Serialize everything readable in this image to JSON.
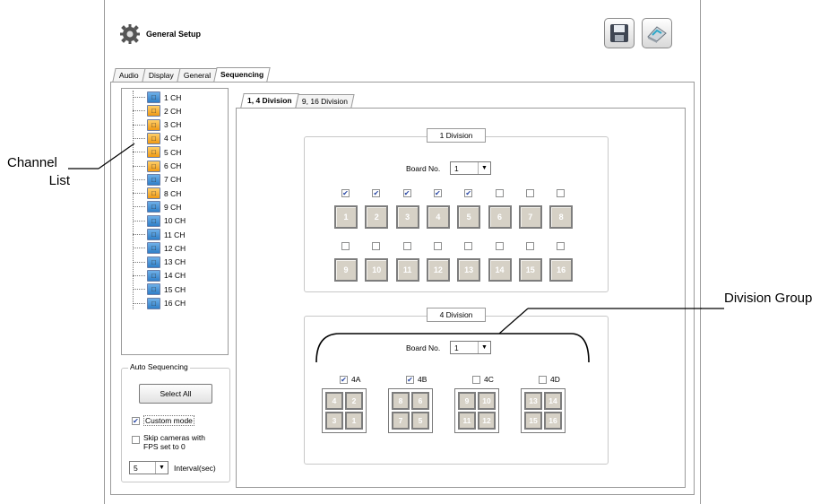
{
  "window": {
    "title": "General Setup"
  },
  "toolbar": {
    "save_icon": "floppy-disk-icon",
    "exit_icon": "exit-icon"
  },
  "main_tabs": [
    {
      "label": "Audio",
      "active": false
    },
    {
      "label": "Display",
      "active": false
    },
    {
      "label": "General",
      "active": false
    },
    {
      "label": "Sequencing",
      "active": true
    }
  ],
  "channel_list": {
    "items": [
      {
        "label": "1 CH",
        "color": "blue"
      },
      {
        "label": "2 CH",
        "color": "orange"
      },
      {
        "label": "3 CH",
        "color": "orange"
      },
      {
        "label": "4 CH",
        "color": "orange"
      },
      {
        "label": "5 CH",
        "color": "orange"
      },
      {
        "label": "6 CH",
        "color": "orange"
      },
      {
        "label": "7 CH",
        "color": "blue"
      },
      {
        "label": "8 CH",
        "color": "orange"
      },
      {
        "label": "9 CH",
        "color": "blue"
      },
      {
        "label": "10 CH",
        "color": "blue"
      },
      {
        "label": "11 CH",
        "color": "blue"
      },
      {
        "label": "12 CH",
        "color": "blue"
      },
      {
        "label": "13 CH",
        "color": "blue"
      },
      {
        "label": "14 CH",
        "color": "blue"
      },
      {
        "label": "15 CH",
        "color": "blue"
      },
      {
        "label": "16 CH",
        "color": "blue"
      }
    ]
  },
  "auto_sequencing": {
    "title": "Auto Sequencing",
    "select_all": "Select All",
    "custom_mode": {
      "label": "Custom mode",
      "checked": true
    },
    "skip_fps": {
      "label_line1": "Skip cameras with",
      "label_line2": "FPS set to 0",
      "checked": false
    },
    "interval": {
      "value": "5",
      "label": "Interval(sec)"
    }
  },
  "sub_tabs": [
    {
      "label": "1, 4 Division",
      "active": true
    },
    {
      "label": "9, 16 Division",
      "active": false
    }
  ],
  "division1": {
    "title": "1 Division",
    "board_label": "Board No.",
    "board_value": "1",
    "channels": [
      {
        "n": "1",
        "checked": true
      },
      {
        "n": "2",
        "checked": true
      },
      {
        "n": "3",
        "checked": true
      },
      {
        "n": "4",
        "checked": true
      },
      {
        "n": "5",
        "checked": true
      },
      {
        "n": "6",
        "checked": false
      },
      {
        "n": "7",
        "checked": false
      },
      {
        "n": "8",
        "checked": false
      },
      {
        "n": "9",
        "checked": false
      },
      {
        "n": "10",
        "checked": false
      },
      {
        "n": "11",
        "checked": false
      },
      {
        "n": "12",
        "checked": false
      },
      {
        "n": "13",
        "checked": false
      },
      {
        "n": "14",
        "checked": false
      },
      {
        "n": "15",
        "checked": false
      },
      {
        "n": "16",
        "checked": false
      }
    ]
  },
  "division4": {
    "title": "4 Division",
    "board_label": "Board No.",
    "board_value": "1",
    "groups": [
      {
        "label": "4A",
        "checked": true,
        "cells": [
          "4",
          "2",
          "3",
          "1"
        ]
      },
      {
        "label": "4B",
        "checked": true,
        "cells": [
          "8",
          "6",
          "7",
          "5"
        ]
      },
      {
        "label": "4C",
        "checked": false,
        "cells": [
          "9",
          "10",
          "11",
          "12"
        ]
      },
      {
        "label": "4D",
        "checked": false,
        "cells": [
          "13",
          "14",
          "15",
          "16"
        ]
      }
    ]
  },
  "callouts": {
    "channel_list_line1": "Channel",
    "channel_list_line2": "List",
    "division_group": "Division Group"
  }
}
